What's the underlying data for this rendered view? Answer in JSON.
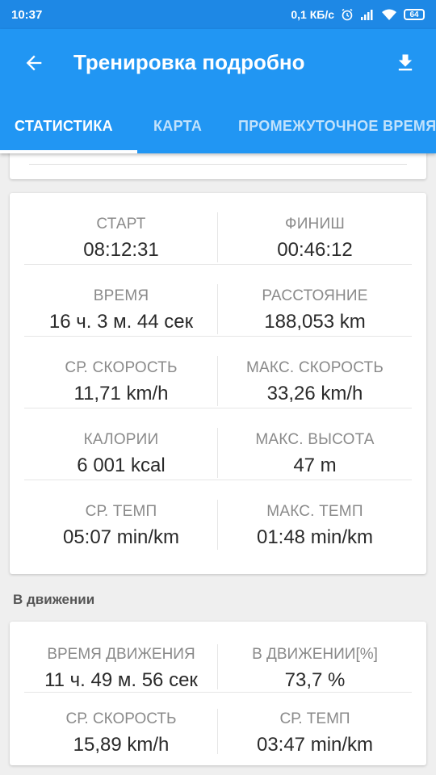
{
  "status_bar": {
    "time": "10:37",
    "network_speed": "0,1 КБ/с",
    "battery": "64"
  },
  "toolbar": {
    "title": "Тренировка подробно"
  },
  "tabs": [
    {
      "label": "СТАТИСТИКА",
      "active": true
    },
    {
      "label": "КАРТА",
      "active": false
    },
    {
      "label": "ПРОМЕЖУТОЧНОЕ ВРЕМЯ",
      "active": false
    }
  ],
  "stats": [
    {
      "left": {
        "label": "СТАРТ",
        "value": "08:12:31"
      },
      "right": {
        "label": "ФИНИШ",
        "value": "00:46:12"
      }
    },
    {
      "left": {
        "label": "ВРЕМЯ",
        "value": "16 ч. 3 м. 44 сек"
      },
      "right": {
        "label": "РАССТОЯНИЕ",
        "value": "188,053 km"
      }
    },
    {
      "left": {
        "label": "СР. СКОРОСТЬ",
        "value": "11,71 km/h"
      },
      "right": {
        "label": "МАКС. СКОРОСТЬ",
        "value": "33,26 km/h"
      }
    },
    {
      "left": {
        "label": "КАЛОРИИ",
        "value": "6 001 kcal"
      },
      "right": {
        "label": "МАКС. ВЫСОТА",
        "value": "47 m"
      }
    },
    {
      "left": {
        "label": "СР. ТЕМП",
        "value": "05:07 min/km"
      },
      "right": {
        "label": "МАКС. ТЕМП",
        "value": "01:48 min/km"
      }
    }
  ],
  "moving": {
    "section_title": "В движении",
    "rows": [
      {
        "left": {
          "label": "ВРЕМЯ ДВИЖЕНИЯ",
          "value": "11 ч. 49 м. 56 сек"
        },
        "right": {
          "label": "В ДВИЖЕНИИ[%]",
          "value": "73,7 %"
        }
      },
      {
        "left": {
          "label": "СР. СКОРОСТЬ",
          "value": "15,89 km/h"
        },
        "right": {
          "label": "СР. ТЕМП",
          "value": "03:47 min/km"
        }
      }
    ]
  },
  "colors": {
    "status_bar": "#1e88e5",
    "app_bar": "#2196f3",
    "background": "#efefef"
  }
}
